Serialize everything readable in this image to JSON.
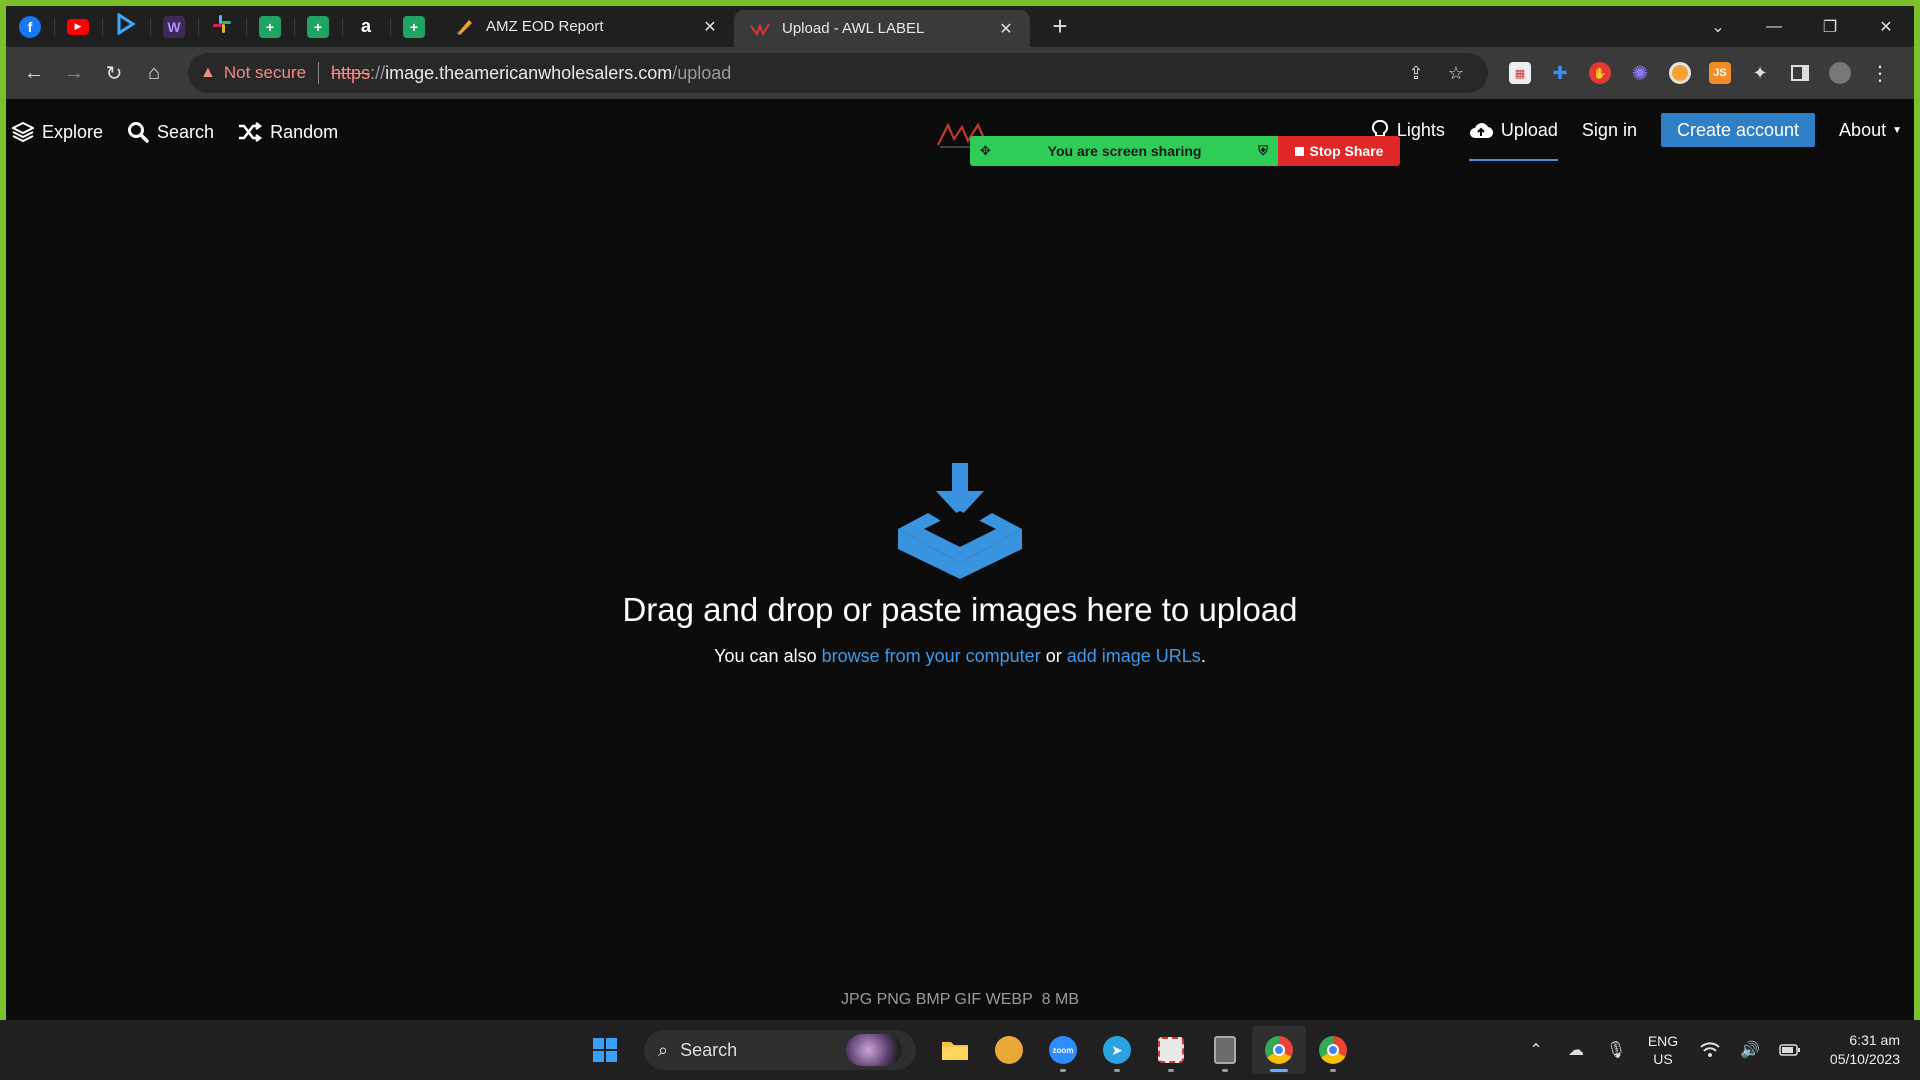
{
  "browser": {
    "tabs": [
      {
        "title": "AMZ EOD Report",
        "active": false
      },
      {
        "title": "Upload - AWL LABEL",
        "active": true
      }
    ],
    "address": {
      "security_label": "Not secure",
      "scheme": "https",
      "host_sep": "://",
      "host": "image.theamericanwholesalers.com",
      "path": "/upload"
    }
  },
  "site_nav": {
    "left": [
      {
        "label": "Explore",
        "icon": "layers-icon"
      },
      {
        "label": "Search",
        "icon": "search-icon"
      },
      {
        "label": "Random",
        "icon": "shuffle-icon"
      }
    ],
    "right": {
      "lights": "Lights",
      "upload": "Upload",
      "signin": "Sign in",
      "create": "Create account",
      "about": "About"
    }
  },
  "share_banner": {
    "message": "You are screen sharing",
    "stop": "Stop Share"
  },
  "upload": {
    "headline": "Drag and drop or paste images here to upload",
    "sub_prefix": "You can also",
    "browse_link": "browse from your computer",
    "sub_or": "or",
    "urls_link": "add image URLs",
    "sub_suffix": ".",
    "formats": "JPG PNG BMP GIF WEBP",
    "max_size": "8 MB"
  },
  "taskbar": {
    "search_label": "Search",
    "lang_top": "ENG",
    "lang_bottom": "US",
    "time": "6:31 am",
    "date": "05/10/2023"
  },
  "colors": {
    "accent": "#2f7fc7",
    "link": "#3d9be9",
    "share_green": "#2fcc58",
    "share_red": "#e02828",
    "frame_green": "#7cc02a"
  }
}
